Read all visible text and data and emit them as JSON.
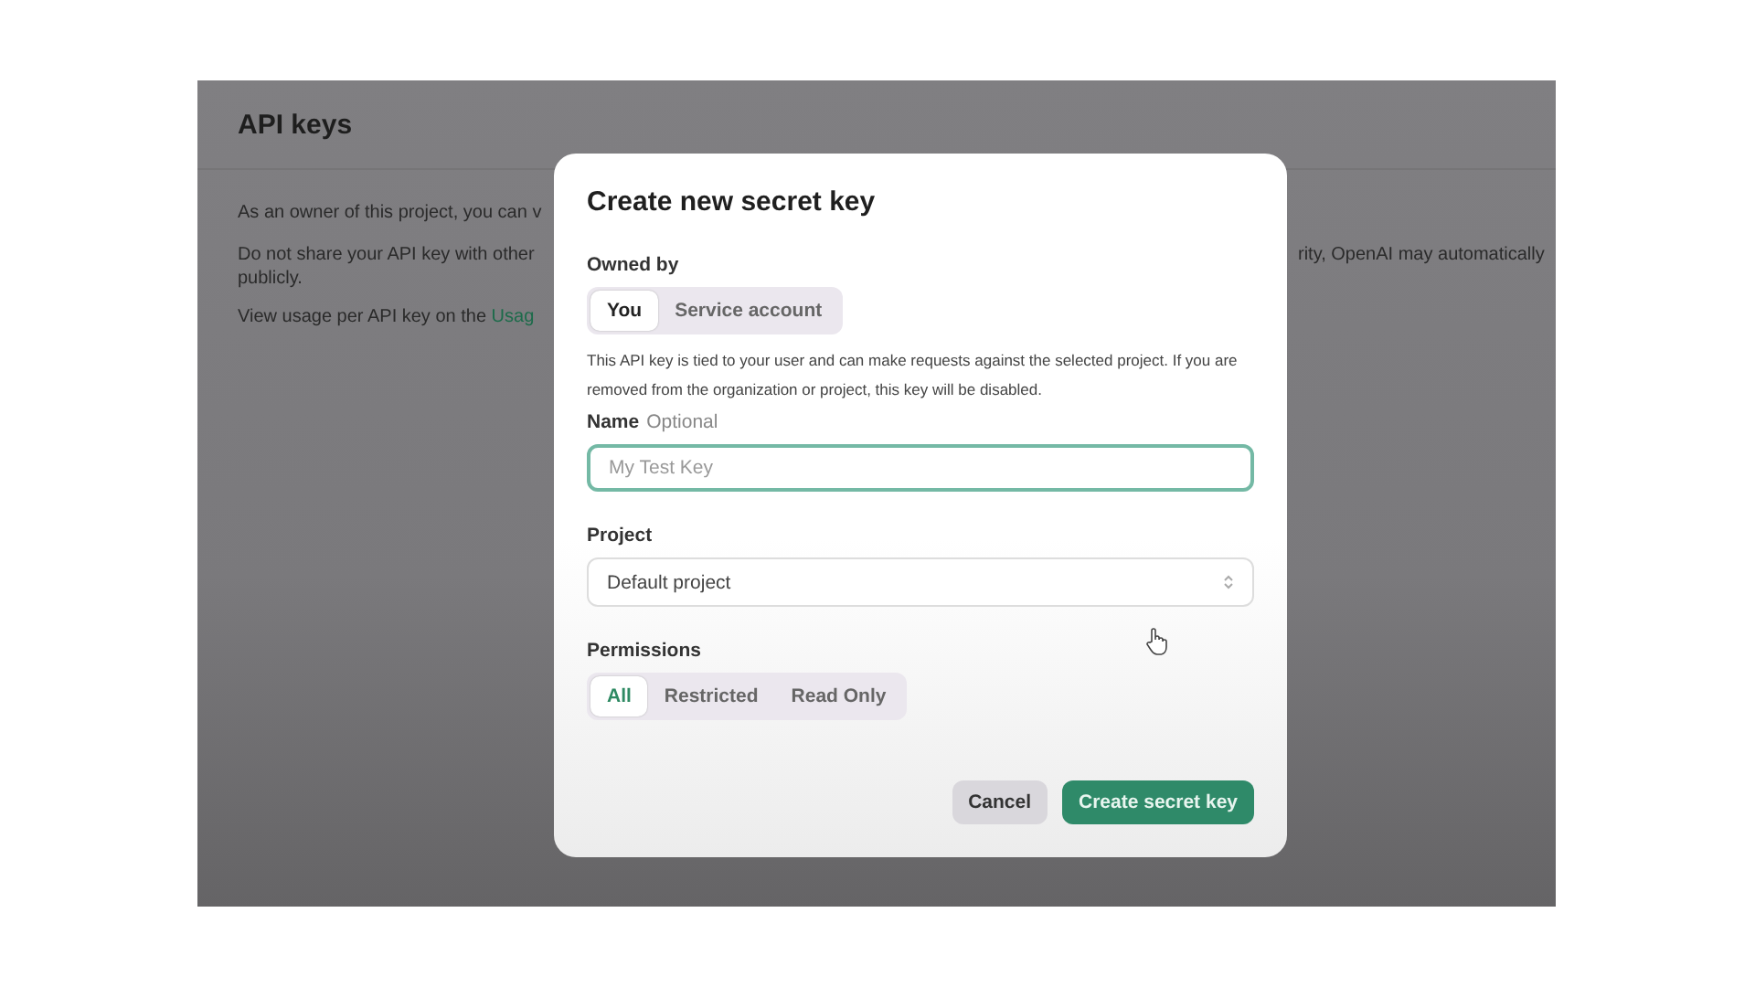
{
  "page": {
    "title": "API keys",
    "paragraphs": [
      {
        "left": "As an owner of this project, you can v"
      },
      {
        "left": "Do not share your API key with other",
        "right": "rity, OpenAI may automatically",
        "continuation": "publicly."
      },
      {
        "left": "View usage per API key on the ",
        "link": "Usag"
      }
    ]
  },
  "dialog": {
    "title": "Create new secret key",
    "owned_by": {
      "label": "Owned by",
      "options": [
        {
          "label": "You",
          "selected": true
        },
        {
          "label": "Service account",
          "selected": false
        }
      ]
    },
    "description": "This API key is tied to your user and can make requests against the selected project. If you are removed from the organization or project, this key will be disabled.",
    "name": {
      "label": "Name",
      "hint": "Optional",
      "placeholder": "My Test Key"
    },
    "project": {
      "label": "Project",
      "value": "Default project"
    },
    "permissions": {
      "label": "Permissions",
      "options": [
        {
          "label": "All",
          "selected": true
        },
        {
          "label": "Restricted",
          "selected": false
        },
        {
          "label": "Read Only",
          "selected": false
        }
      ]
    },
    "buttons": [
      {
        "label": "Cancel",
        "kind": "secondary"
      },
      {
        "label": "Create secret key",
        "kind": "primary"
      }
    ]
  }
}
